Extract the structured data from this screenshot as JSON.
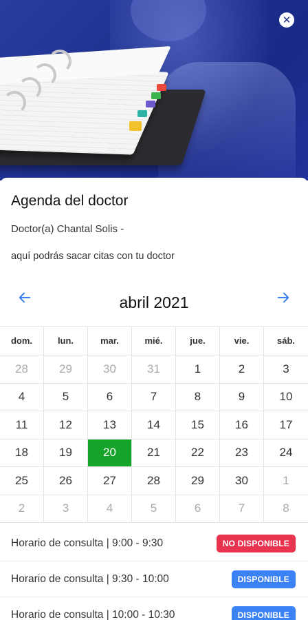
{
  "hero": {
    "close_icon": "close-icon"
  },
  "header": {
    "title": "Agenda del doctor",
    "doctor": "Doctor(a) Chantal Solis -",
    "description": "aquí podrás sacar citas con tu doctor"
  },
  "calendar": {
    "month": "abril 2021",
    "prev_icon": "arrow-left-icon",
    "next_icon": "arrow-right-icon",
    "weekdays": [
      "dom.",
      "lun.",
      "mar.",
      "mié.",
      "jue.",
      "vie.",
      "sáb."
    ],
    "weeks": [
      [
        {
          "d": "28",
          "o": true
        },
        {
          "d": "29",
          "o": true
        },
        {
          "d": "30",
          "o": true
        },
        {
          "d": "31",
          "o": true
        },
        {
          "d": "1"
        },
        {
          "d": "2"
        },
        {
          "d": "3"
        }
      ],
      [
        {
          "d": "4"
        },
        {
          "d": "5"
        },
        {
          "d": "6"
        },
        {
          "d": "7"
        },
        {
          "d": "8"
        },
        {
          "d": "9"
        },
        {
          "d": "10"
        }
      ],
      [
        {
          "d": "11"
        },
        {
          "d": "12"
        },
        {
          "d": "13"
        },
        {
          "d": "14"
        },
        {
          "d": "15"
        },
        {
          "d": "16"
        },
        {
          "d": "17"
        }
      ],
      [
        {
          "d": "18"
        },
        {
          "d": "19"
        },
        {
          "d": "20",
          "s": true
        },
        {
          "d": "21"
        },
        {
          "d": "22"
        },
        {
          "d": "23"
        },
        {
          "d": "24"
        }
      ],
      [
        {
          "d": "25"
        },
        {
          "d": "26"
        },
        {
          "d": "27"
        },
        {
          "d": "28"
        },
        {
          "d": "29"
        },
        {
          "d": "30"
        },
        {
          "d": "1",
          "o": true
        }
      ],
      [
        {
          "d": "2",
          "o": true
        },
        {
          "d": "3",
          "o": true
        },
        {
          "d": "4",
          "o": true
        },
        {
          "d": "5",
          "o": true
        },
        {
          "d": "6",
          "o": true
        },
        {
          "d": "7",
          "o": true
        },
        {
          "d": "8",
          "o": true
        }
      ]
    ],
    "selected_color": "#16a32a"
  },
  "slots": [
    {
      "label": "Horario de consulta | 9:00 - 9:30",
      "status": "NO DISPONIBLE",
      "available": false
    },
    {
      "label": "Horario de consulta | 9:30 - 10:00",
      "status": "DISPONIBLE",
      "available": true
    },
    {
      "label": "Horario de consulta | 10:00 - 10:30",
      "status": "DISPONIBLE",
      "available": true
    }
  ],
  "colors": {
    "available": "#3b82f6",
    "unavailable": "#e8344e",
    "hero": "#1d2f8c"
  }
}
